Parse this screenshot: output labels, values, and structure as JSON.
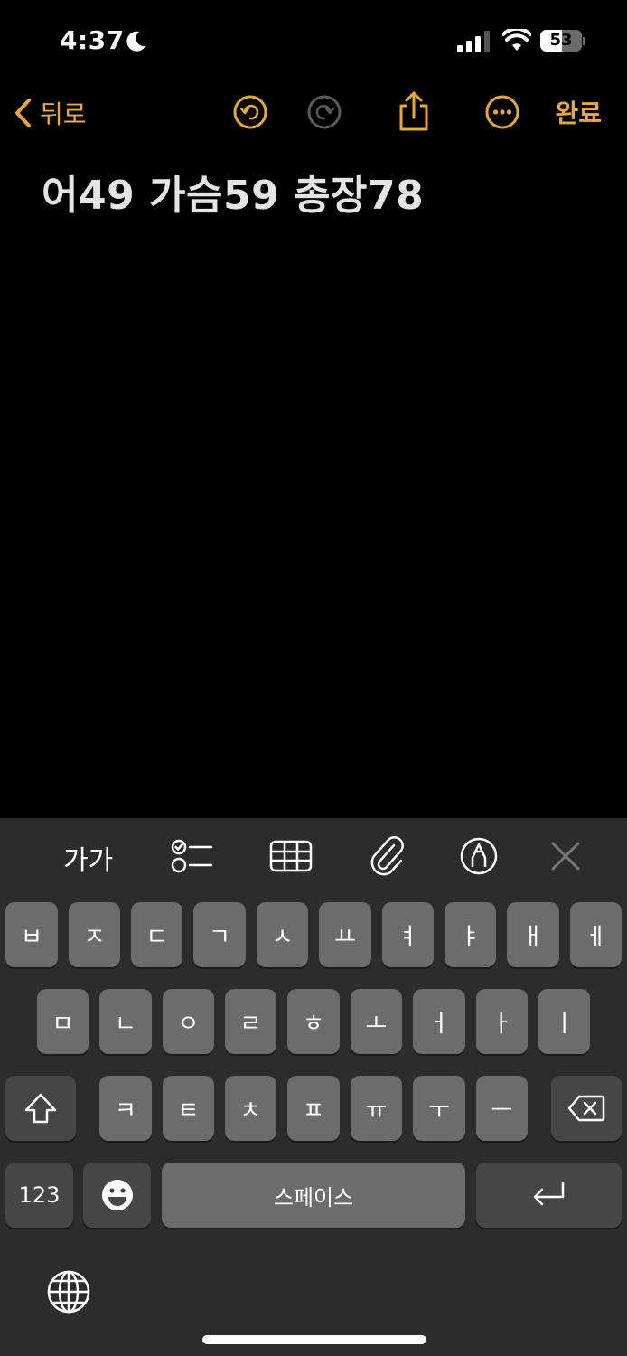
{
  "status_bar": {
    "time": "4:37",
    "battery": "53",
    "battery_level": 0.53
  },
  "nav": {
    "back_label": "뒤로",
    "done_label": "완료"
  },
  "note": {
    "body": "어49 가슴59 총장78"
  },
  "toolbar": {
    "format_label": "가가"
  },
  "keyboard": {
    "row1": [
      "ㅂ",
      "ㅈ",
      "ㄷ",
      "ㄱ",
      "ㅅ",
      "ㅛ",
      "ㅕ",
      "ㅑ",
      "ㅐ",
      "ㅔ"
    ],
    "row2": [
      "ㅁ",
      "ㄴ",
      "ㅇ",
      "ㄹ",
      "ㅎ",
      "ㅗ",
      "ㅓ",
      "ㅏ",
      "ㅣ"
    ],
    "row3": [
      "ㅋ",
      "ㅌ",
      "ㅊ",
      "ㅍ",
      "ㅠ",
      "ㅜ",
      "ㅡ"
    ],
    "numbers_label": "123",
    "space_label": "스페이스"
  },
  "colors": {
    "accent": "#e6a93a",
    "background": "#000000",
    "keyboard_bg": "#2c2c2c",
    "key": "#6c6c6c",
    "key_dark": "#464646"
  }
}
